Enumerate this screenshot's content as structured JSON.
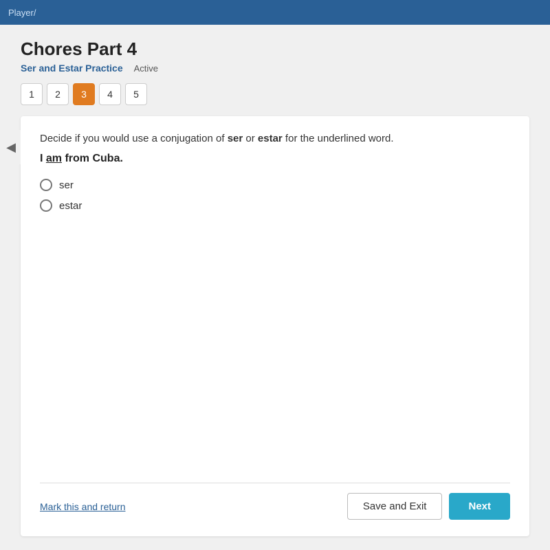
{
  "topbar": {
    "text": "Player/"
  },
  "header": {
    "title": "Chores Part 4",
    "subtitle": "Ser and Estar Practice",
    "status": "Active"
  },
  "pagination": {
    "pages": [
      {
        "label": "1",
        "active": false
      },
      {
        "label": "2",
        "active": false
      },
      {
        "label": "3",
        "active": true
      },
      {
        "label": "4",
        "active": false
      },
      {
        "label": "5",
        "active": false
      }
    ]
  },
  "question": {
    "instruction": "Decide if you would use a conjugation of ser or estar for the underlined word.",
    "instruction_bold1": "ser",
    "instruction_bold2": "estar",
    "sentence_prefix": "I ",
    "sentence_underlined": "am",
    "sentence_suffix": " from Cuba.",
    "options": [
      {
        "label": "ser"
      },
      {
        "label": "estar"
      }
    ]
  },
  "footer": {
    "mark_return": "Mark this and return",
    "save_exit": "Save and Exit",
    "next": "Next"
  }
}
